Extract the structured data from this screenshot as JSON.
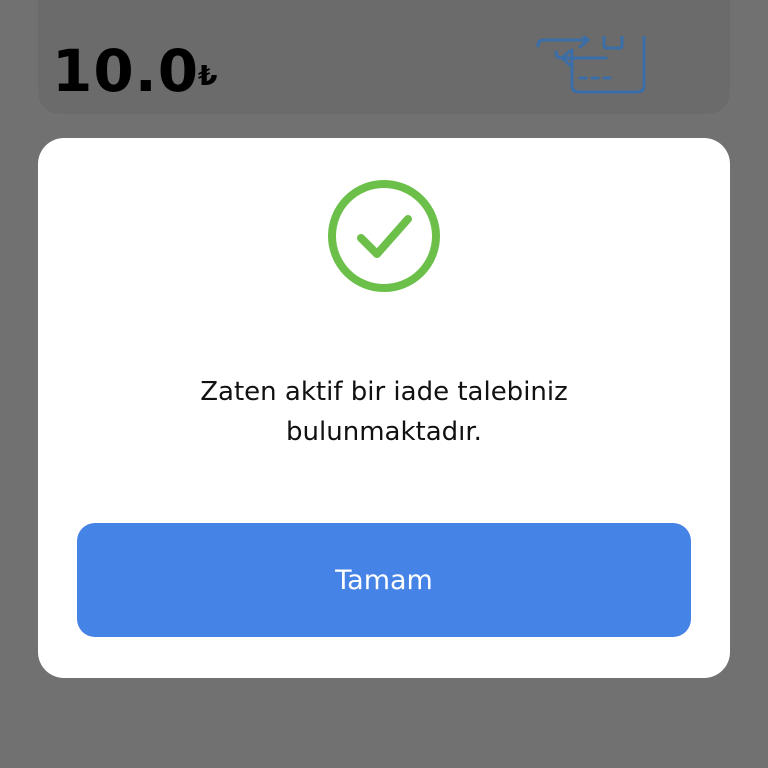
{
  "background_card": {
    "amount": "10.0",
    "currency_symbol": "₺",
    "icon": "card-transfer-icon"
  },
  "dialog": {
    "icon": "check-circle-icon",
    "message": "Zaten aktif bir iade talebiniz bulunmaktadır.",
    "ok_button_label": "Tamam"
  },
  "colors": {
    "backdrop": "#717171",
    "dialog_background": "#ffffff",
    "success_green": "#6cc04a",
    "button_blue": "#4683e6",
    "icon_blue": "#3a6ea8"
  }
}
